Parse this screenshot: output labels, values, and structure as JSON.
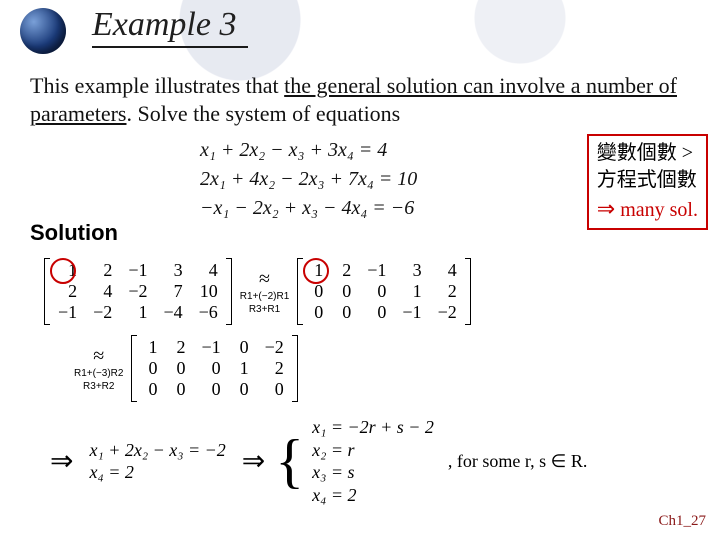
{
  "title": "Example 3",
  "description": {
    "pre": "This example illustrates that ",
    "underlined": "the general solution can involve a number of parameters",
    "post": ". Solve the system of equations"
  },
  "system": {
    "line1": "x₁ + 2x₂ − x₃ + 3x₄ = 4",
    "line2": "2x₁ + 4x₂ − 2x₃ + 7x₄ = 10",
    "line3": "−x₁ − 2x₂ + x₃ − 4x₄ = −6"
  },
  "annotation": {
    "l1": "變數個數 >",
    "l2": "方程式個數",
    "l3_sym": "⇒",
    "l3_text": " many sol."
  },
  "solution_label": "Solution",
  "matrices": {
    "A": [
      [
        "1",
        "2",
        "−1",
        "3",
        "4"
      ],
      [
        "2",
        "4",
        "−2",
        "7",
        "10"
      ],
      [
        "−1",
        "−2",
        "1",
        "−4",
        "−6"
      ]
    ],
    "B": [
      [
        "1",
        "2",
        "−1",
        "3",
        "4"
      ],
      [
        "0",
        "0",
        "0",
        "1",
        "2"
      ],
      [
        "0",
        "0",
        "0",
        "−1",
        "−2"
      ]
    ],
    "C": [
      [
        "1",
        "2",
        "−1",
        "0",
        "−2"
      ],
      [
        "0",
        "0",
        "0",
        "1",
        "2"
      ],
      [
        "0",
        "0",
        "0",
        "0",
        "0"
      ]
    ]
  },
  "rowops": {
    "step1a": "R1+(−2)R1",
    "step1b": "R3+R1",
    "step2a": "R1+(−3)R2",
    "step2b": "R3+R2"
  },
  "implications": {
    "eq_pair": {
      "line1": "x₁ + 2x₂ − x₃ = −2",
      "line2": "x₄ = 2"
    },
    "param_sol": {
      "l1": "x₁ = −2r + s − 2",
      "l2": "x₂ = r",
      "l3": "x₃ = s",
      "l4": "x₄ = 2"
    },
    "for_some": ", for some r, s ∈ R."
  },
  "footer": "Ch1_27"
}
